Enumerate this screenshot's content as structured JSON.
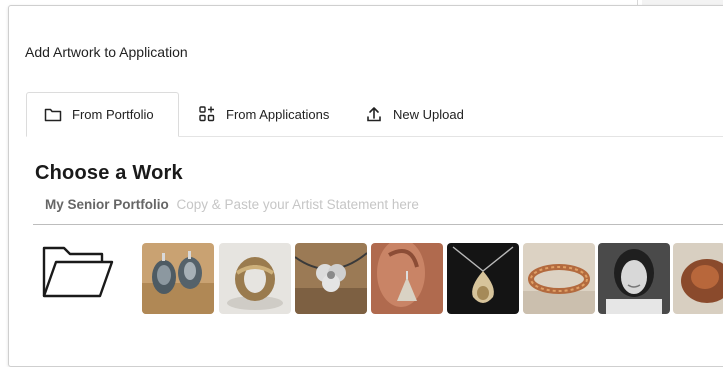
{
  "dialog": {
    "title": "Add Artwork to Application"
  },
  "tabs": [
    {
      "label": "From Portfolio",
      "icon": "folder-icon",
      "active": true
    },
    {
      "label": "From Applications",
      "icon": "apps-add-icon",
      "active": false
    },
    {
      "label": "New Upload",
      "icon": "upload-icon",
      "active": false
    }
  ],
  "section": {
    "heading": "Choose a Work",
    "portfolio_name": "My Senior Portfolio",
    "portfolio_description": "Copy & Paste your Artist Statement here"
  },
  "works": {
    "folder_icon": "folder-open-icon",
    "thumbnails": [
      {
        "subject": "metal-earrings-pair"
      },
      {
        "subject": "metal-ring"
      },
      {
        "subject": "flower-pendant"
      },
      {
        "subject": "earring-on-ear"
      },
      {
        "subject": "teardrop-pendant"
      },
      {
        "subject": "beaded-bracelet"
      },
      {
        "subject": "portrait-photo"
      },
      {
        "subject": "copper-object"
      }
    ]
  },
  "colors": {
    "border": "#cfcfcf",
    "muted_text": "#c6c6c6",
    "heading": "#1a1a1a"
  }
}
